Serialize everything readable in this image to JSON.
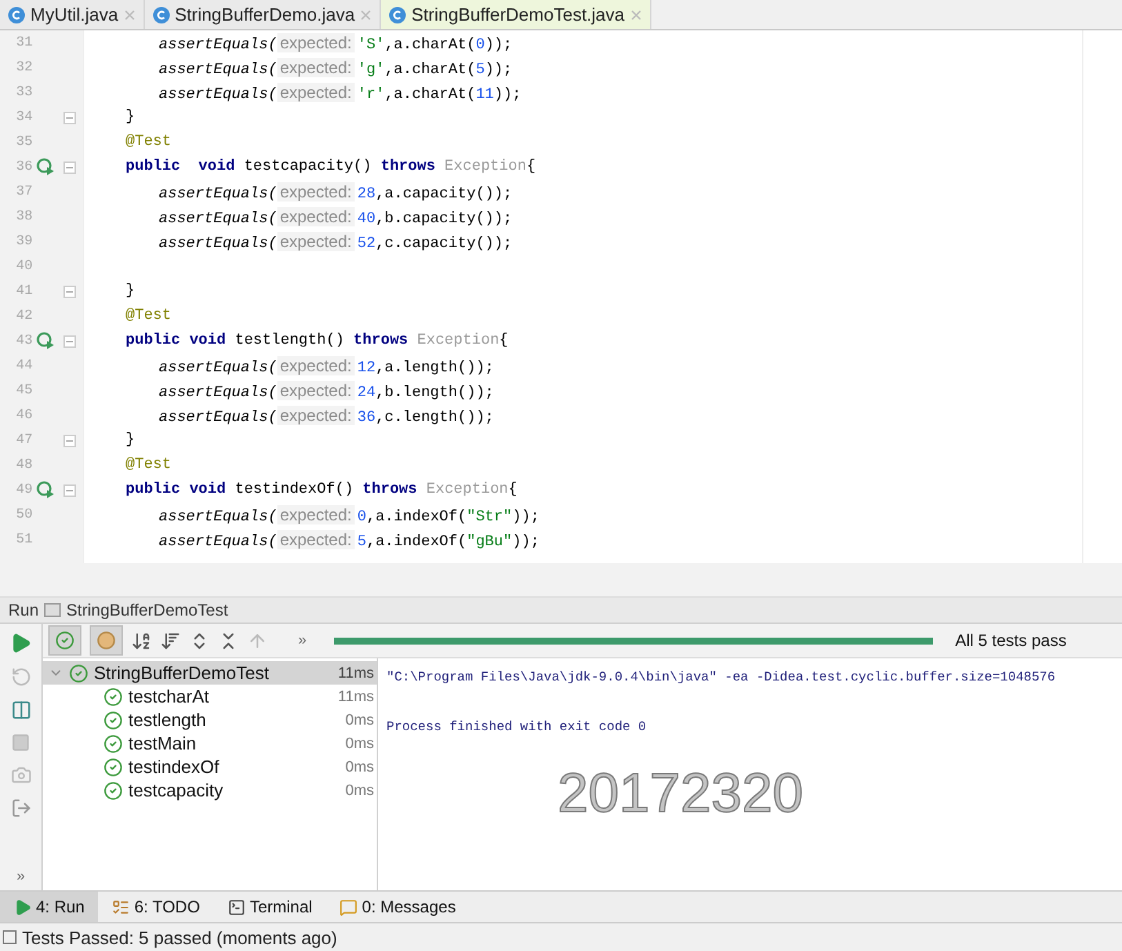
{
  "editor_tabs": [
    {
      "label": "MyUtil.java",
      "selected": false
    },
    {
      "label": "StringBufferDemo.java",
      "selected": false
    },
    {
      "label": "StringBufferDemoTest.java",
      "selected": true
    }
  ],
  "code_lines": [
    {
      "number": "31",
      "run_marker": false,
      "fold_marker": false,
      "kind": "statement",
      "tokens": [
        {
          "kind": "fn",
          "text": "assertEquals("
        },
        {
          "kind": "hint",
          "text": "expected:"
        },
        {
          "kind": "str",
          "text": "'S'"
        },
        {
          "kind": "plain",
          "text": ",a.charAt("
        },
        {
          "kind": "num",
          "text": "0"
        },
        {
          "kind": "plain",
          "text": "));"
        }
      ]
    },
    {
      "number": "32",
      "run_marker": false,
      "fold_marker": false,
      "kind": "statement",
      "tokens": [
        {
          "kind": "fn",
          "text": "assertEquals("
        },
        {
          "kind": "hint",
          "text": "expected:"
        },
        {
          "kind": "str",
          "text": "'g'"
        },
        {
          "kind": "plain",
          "text": ",a.charAt("
        },
        {
          "kind": "num",
          "text": "5"
        },
        {
          "kind": "plain",
          "text": "));"
        }
      ]
    },
    {
      "number": "33",
      "run_marker": false,
      "fold_marker": false,
      "kind": "statement",
      "tokens": [
        {
          "kind": "fn",
          "text": "assertEquals("
        },
        {
          "kind": "hint",
          "text": "expected:"
        },
        {
          "kind": "str",
          "text": "'r'"
        },
        {
          "kind": "plain",
          "text": ",a.charAt("
        },
        {
          "kind": "num",
          "text": "11"
        },
        {
          "kind": "plain",
          "text": "));"
        }
      ]
    },
    {
      "number": "34",
      "run_marker": false,
      "fold_marker": true,
      "kind": "declaration",
      "tokens": [
        {
          "kind": "plain",
          "text": "}"
        }
      ]
    },
    {
      "number": "35",
      "run_marker": false,
      "fold_marker": false,
      "kind": "declaration",
      "tokens": [
        {
          "kind": "ann",
          "text": "@Test"
        }
      ]
    },
    {
      "number": "36",
      "run_marker": true,
      "fold_marker": true,
      "kind": "declaration",
      "tokens": [
        {
          "kind": "kw",
          "text": "public"
        },
        {
          "kind": "kw",
          "text": "  void"
        },
        {
          "kind": "plain",
          "text": " testcapacity() "
        },
        {
          "kind": "kw",
          "text": "throws"
        },
        {
          "kind": "type",
          "text": " Exception"
        },
        {
          "kind": "plain",
          "text": "{"
        }
      ]
    },
    {
      "number": "37",
      "run_marker": false,
      "fold_marker": false,
      "kind": "statement",
      "tokens": [
        {
          "kind": "fn",
          "text": "assertEquals("
        },
        {
          "kind": "hint",
          "text": "expected:"
        },
        {
          "kind": "num",
          "text": "28"
        },
        {
          "kind": "plain",
          "text": ",a.capacity());"
        }
      ]
    },
    {
      "number": "38",
      "run_marker": false,
      "fold_marker": false,
      "kind": "statement",
      "tokens": [
        {
          "kind": "fn",
          "text": "assertEquals("
        },
        {
          "kind": "hint",
          "text": "expected:"
        },
        {
          "kind": "num",
          "text": "40"
        },
        {
          "kind": "plain",
          "text": ",b.capacity());"
        }
      ]
    },
    {
      "number": "39",
      "run_marker": false,
      "fold_marker": false,
      "kind": "statement",
      "tokens": [
        {
          "kind": "fn",
          "text": "assertEquals("
        },
        {
          "kind": "hint",
          "text": "expected:"
        },
        {
          "kind": "num",
          "text": "52"
        },
        {
          "kind": "plain",
          "text": ",c.capacity());"
        }
      ]
    },
    {
      "number": "40",
      "run_marker": false,
      "fold_marker": false,
      "kind": "blank"
    },
    {
      "number": "41",
      "run_marker": false,
      "fold_marker": true,
      "kind": "declaration",
      "tokens": [
        {
          "kind": "plain",
          "text": "}"
        }
      ]
    },
    {
      "number": "42",
      "run_marker": false,
      "fold_marker": false,
      "kind": "declaration",
      "tokens": [
        {
          "kind": "ann",
          "text": "@Test"
        }
      ]
    },
    {
      "number": "43",
      "run_marker": true,
      "fold_marker": true,
      "kind": "declaration",
      "tokens": [
        {
          "kind": "kw",
          "text": "public"
        },
        {
          "kind": "kw",
          "text": " void"
        },
        {
          "kind": "plain",
          "text": " testlength() "
        },
        {
          "kind": "kw",
          "text": "throws"
        },
        {
          "kind": "type",
          "text": " Exception"
        },
        {
          "kind": "plain",
          "text": "{"
        }
      ]
    },
    {
      "number": "44",
      "run_marker": false,
      "fold_marker": false,
      "kind": "statement",
      "tokens": [
        {
          "kind": "fn",
          "text": "assertEquals("
        },
        {
          "kind": "hint",
          "text": "expected:"
        },
        {
          "kind": "num",
          "text": "12"
        },
        {
          "kind": "plain",
          "text": ",a.length());"
        }
      ]
    },
    {
      "number": "45",
      "run_marker": false,
      "fold_marker": false,
      "kind": "statement",
      "tokens": [
        {
          "kind": "fn",
          "text": "assertEquals("
        },
        {
          "kind": "hint",
          "text": "expected:"
        },
        {
          "kind": "num",
          "text": "24"
        },
        {
          "kind": "plain",
          "text": ",b.length());"
        }
      ]
    },
    {
      "number": "46",
      "run_marker": false,
      "fold_marker": false,
      "kind": "statement",
      "tokens": [
        {
          "kind": "fn",
          "text": "assertEquals("
        },
        {
          "kind": "hint",
          "text": "expected:"
        },
        {
          "kind": "num",
          "text": "36"
        },
        {
          "kind": "plain",
          "text": ",c.length());"
        }
      ]
    },
    {
      "number": "47",
      "run_marker": false,
      "fold_marker": true,
      "kind": "declaration",
      "tokens": [
        {
          "kind": "plain",
          "text": "}"
        }
      ]
    },
    {
      "number": "48",
      "run_marker": false,
      "fold_marker": false,
      "kind": "declaration",
      "tokens": [
        {
          "kind": "ann",
          "text": "@Test"
        }
      ]
    },
    {
      "number": "49",
      "run_marker": true,
      "fold_marker": true,
      "kind": "declaration",
      "tokens": [
        {
          "kind": "kw",
          "text": "public"
        },
        {
          "kind": "kw",
          "text": " void"
        },
        {
          "kind": "plain",
          "text": " testindexOf() "
        },
        {
          "kind": "kw",
          "text": "throws"
        },
        {
          "kind": "type",
          "text": " Exception"
        },
        {
          "kind": "plain",
          "text": "{"
        }
      ]
    },
    {
      "number": "50",
      "run_marker": false,
      "fold_marker": false,
      "kind": "statement",
      "tokens": [
        {
          "kind": "fn",
          "text": "assertEquals("
        },
        {
          "kind": "hint",
          "text": "expected:"
        },
        {
          "kind": "num",
          "text": "0"
        },
        {
          "kind": "plain",
          "text": ",a.indexOf("
        },
        {
          "kind": "str",
          "text": "\"Str\""
        },
        {
          "kind": "plain",
          "text": "));"
        }
      ]
    },
    {
      "number": "51",
      "run_marker": false,
      "fold_marker": false,
      "kind": "statement",
      "tokens": [
        {
          "kind": "fn",
          "text": "assertEquals("
        },
        {
          "kind": "hint",
          "text": "expected:"
        },
        {
          "kind": "num",
          "text": "5"
        },
        {
          "kind": "plain",
          "text": ",a.indexOf("
        },
        {
          "kind": "str",
          "text": "\"gBu\""
        },
        {
          "kind": "plain",
          "text": "));"
        }
      ]
    }
  ],
  "run_panel": {
    "title": "Run",
    "configuration": "StringBufferDemoTest",
    "side_overflow": "»",
    "toolbar_overflow": "»",
    "filters": [
      {
        "kind": "passed",
        "selected": true
      },
      {
        "kind": "ignored",
        "selected": true
      }
    ],
    "progress": {
      "level": 1,
      "status": "All 5 tests pass"
    },
    "test_tree": {
      "name": "StringBufferDemoTest",
      "time": "11ms",
      "passed": true,
      "expanded": true,
      "selected": true,
      "children": [
        {
          "name": "testcharAt",
          "time": "11ms",
          "passed": true,
          "selected": false
        },
        {
          "name": "testlength",
          "time": "0ms",
          "passed": true,
          "selected": false
        },
        {
          "name": "testMain",
          "time": "0ms",
          "passed": true,
          "selected": false
        },
        {
          "name": "testindexOf",
          "time": "0ms",
          "passed": true,
          "selected": false
        },
        {
          "name": "testcapacity",
          "time": "0ms",
          "passed": true,
          "selected": false
        }
      ]
    },
    "console": [
      "\"C:\\Program Files\\Java\\jdk-9.0.4\\bin\\java\" -ea -Didea.test.cyclic.buffer.size=1048576",
      "Process finished with exit code 0"
    ],
    "overlay_label": "20172320"
  },
  "tool_tabs": [
    {
      "kind": "run",
      "label": "4: Run",
      "selected": true
    },
    {
      "kind": "todo",
      "label": "6: TODO",
      "selected": false
    },
    {
      "kind": "terminal",
      "label": "Terminal",
      "selected": false
    },
    {
      "kind": "messages",
      "label": "0: Messages",
      "selected": false
    }
  ],
  "status_bar": "Tests Passed: 5 passed (moments ago)"
}
